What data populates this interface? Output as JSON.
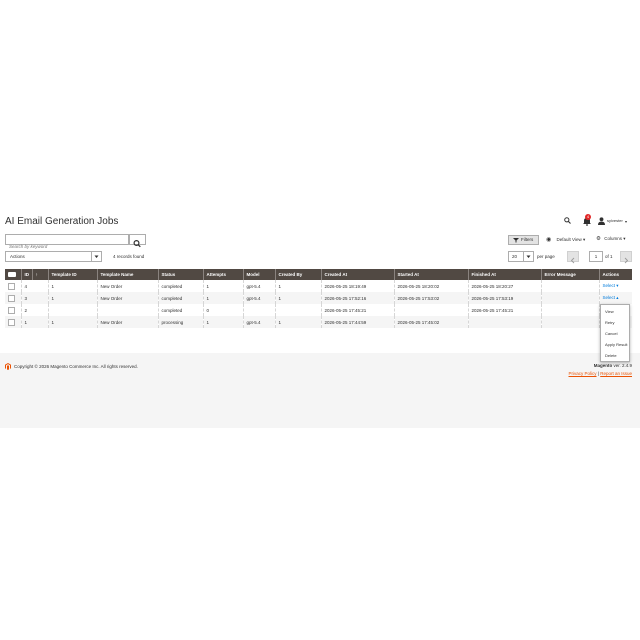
{
  "header": {
    "title": "AI Email Generation Jobs",
    "notifications_count": "4",
    "user_name": "sylvester"
  },
  "toolbar": {
    "search_placeholder": "Search by keyword",
    "filters_label": "Filters",
    "view_label": "Default View",
    "columns_label": "Columns",
    "actions_label": "Actions",
    "records_found": "4 records found",
    "per_page_value": "20",
    "per_page_label": "per page",
    "page_current": "1",
    "page_of": "of 1"
  },
  "table": {
    "columns": [
      "ID",
      "Template ID",
      "Template Name",
      "Status",
      "Attempts",
      "Model",
      "Created By",
      "Created At",
      "Started At",
      "Finished At",
      "Error Message",
      "Actions"
    ],
    "rows": [
      {
        "id": "4",
        "template_id": "1",
        "template_name": "New Order",
        "status": "completed",
        "attempts": "1",
        "model": "gpt-5.4",
        "created_by": "1",
        "created_at": "2026-05-25 18:19:49",
        "started_at": "2026-05-25 18:20:02",
        "finished_at": "2026-05-25 18:20:27",
        "error": "",
        "action": "Select"
      },
      {
        "id": "3",
        "template_id": "1",
        "template_name": "New Order",
        "status": "completed",
        "attempts": "1",
        "model": "gpt-5.4",
        "created_by": "1",
        "created_at": "2026-05-25 17:52:16",
        "started_at": "2026-05-25 17:53:02",
        "finished_at": "2026-05-25 17:53:19",
        "error": "",
        "action": "Select"
      },
      {
        "id": "2",
        "template_id": "",
        "template_name": "",
        "status": "completed",
        "attempts": "0",
        "model": "",
        "created_by": "",
        "created_at": "2026-05-25 17:45:21",
        "started_at": "",
        "finished_at": "2026-05-25 17:45:21",
        "error": "",
        "action": ""
      },
      {
        "id": "1",
        "template_id": "1",
        "template_name": "New Order",
        "status": "processing",
        "attempts": "1",
        "model": "gpt-5.4",
        "created_by": "1",
        "created_at": "2026-05-25 17:44:59",
        "started_at": "2026-05-25 17:45:02",
        "finished_at": "",
        "error": "",
        "action": ""
      }
    ]
  },
  "row_actions_menu": [
    "View",
    "Retry",
    "Cancel",
    "Apply Result",
    "Delete"
  ],
  "footer": {
    "copyright": "Copyright © 2026 Magento Commerce Inc. All rights reserved.",
    "brand": "Magento",
    "version": "ver. 2.4.9",
    "privacy_link": "Privacy Policy",
    "report_link": "Report an Issue"
  },
  "colors": {
    "table_header_bg": "#514943",
    "link_blue": "#007bdb",
    "accent_orange": "#eb5202",
    "badge_red": "#e22626"
  }
}
